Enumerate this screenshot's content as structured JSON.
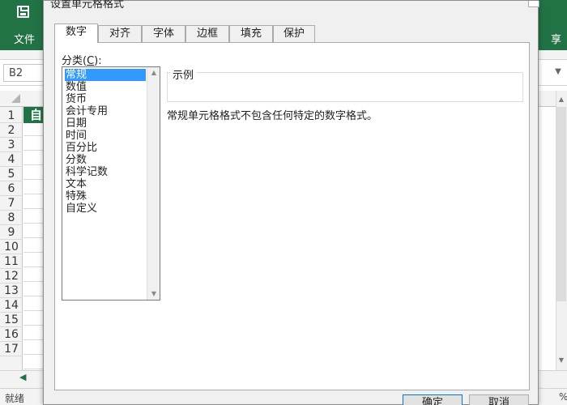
{
  "excel": {
    "ribbon_tab_file": "文件",
    "ribbon_share": "享",
    "name_box": "B2",
    "selected_cell_text": "自",
    "row_numbers": [
      "1",
      "2",
      "3",
      "4",
      "5",
      "6",
      "7",
      "8",
      "9",
      "10",
      "11",
      "12",
      "13",
      "14",
      "15",
      "16",
      "17"
    ],
    "status_text": "就绪",
    "zoom_text": "%",
    "colors": {
      "accent": "#217346",
      "selection": "#3399ff"
    }
  },
  "dialog": {
    "title": "设置单元格格式",
    "tabs": [
      {
        "label": "数字",
        "active": true
      },
      {
        "label": "对齐"
      },
      {
        "label": "字体"
      },
      {
        "label": "边框"
      },
      {
        "label": "填充"
      },
      {
        "label": "保护"
      }
    ],
    "category_label": "分类(C):",
    "category_label_main": "分类(",
    "category_label_key": "C",
    "category_label_tail": "):",
    "categories": [
      "常规",
      "数值",
      "货币",
      "会计专用",
      "日期",
      "时间",
      "百分比",
      "分数",
      "科学记数",
      "文本",
      "特殊",
      "自定义"
    ],
    "selected_category": "常规",
    "sample_label": "示例",
    "description": "常规单元格格式不包含任何特定的数字格式。",
    "ok_button": "确定",
    "cancel_button": "取消"
  }
}
